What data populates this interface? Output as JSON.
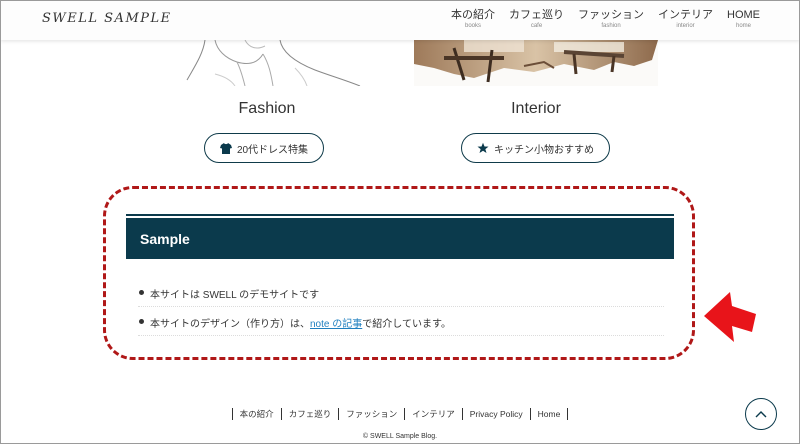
{
  "header": {
    "logo": "SWELL SAMPLE",
    "nav": [
      {
        "label": "本の紹介",
        "sub": "books"
      },
      {
        "label": "カフェ巡り",
        "sub": "cafe"
      },
      {
        "label": "ファッション",
        "sub": "fashion"
      },
      {
        "label": "インテリア",
        "sub": "interior"
      },
      {
        "label": "HOME",
        "sub": "home"
      }
    ]
  },
  "categories": [
    {
      "title": "Fashion",
      "button_label": "20代ドレス特集",
      "icon": "shirt-icon"
    },
    {
      "title": "Interior",
      "button_label": "キッチン小物おすすめ",
      "icon": "star-icon"
    }
  ],
  "sample": {
    "heading": "Sample",
    "items": [
      {
        "text": "本サイトは SWELL のデモサイトです"
      },
      {
        "prefix": "本サイトのデザイン（作り方）は、",
        "link": "note の記事",
        "suffix": "で紹介しています。"
      }
    ]
  },
  "footer": {
    "links": [
      "本の紹介",
      "カフェ巡り",
      "ファッション",
      "インテリア",
      "Privacy Policy",
      "Home"
    ],
    "copyright": "© SWELL Sample Blog."
  },
  "colors": {
    "accent": "#0b3a4c",
    "highlight_border": "#b01818",
    "arrow": "#e8141a",
    "link": "#1f7fbf"
  }
}
